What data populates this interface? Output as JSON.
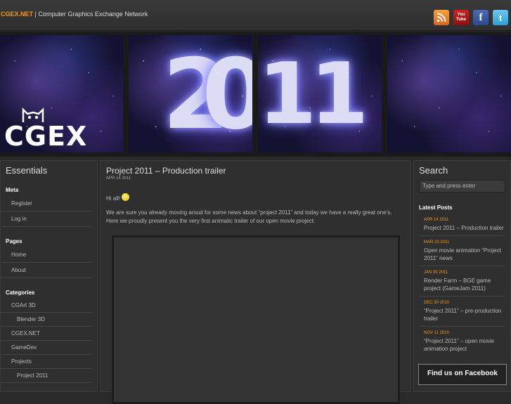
{
  "header": {
    "brand": "CGEX.NET",
    "tagline": " | Computer Graphics Exchange Network",
    "social": {
      "youtube_top": "You",
      "youtube_bottom": "Tube",
      "facebook": "f",
      "twitter": "t"
    }
  },
  "banner": {
    "digits": [
      "2",
      "0",
      "1",
      "1"
    ],
    "logo": "CGEX"
  },
  "sidebar_left": {
    "title": "Essentials",
    "meta_title": "Meta",
    "meta_items": [
      "Register",
      "Log in"
    ],
    "pages_title": "Pages",
    "pages_items": [
      "Home",
      "About"
    ],
    "categories_title": "Categories",
    "categories_items": [
      "CGArt 3D",
      "Blender 3D",
      "CGEX.NET",
      "GameDev",
      "Projects",
      "Project 2011"
    ]
  },
  "post": {
    "title": "Project 2011 – Production trailer",
    "date": "APR 14 2011",
    "greeting": "Hi all!",
    "body": "We are sure you already moving aroud for some news about “project 2011” and today we have a really great one's. Here we proudly present you the very first animatic trailer of our open movie project:"
  },
  "sidebar_right": {
    "search_title": "Search",
    "search_placeholder": "Type and press enter",
    "latest_title": "Latest Posts",
    "latest": [
      {
        "date": "APR 14 2011",
        "title": "Project 2011 – Production trailer"
      },
      {
        "date": "MAR 23 2011",
        "title": "Open movie animation “Project 2011” news"
      },
      {
        "date": "JAN 30 2011",
        "title": "Render Farm – BGE game project (GameJam 2011)"
      },
      {
        "date": "DEC 30 2010",
        "title": "“Project 2011” – pre-production trailer"
      },
      {
        "date": "NOV 11 2010",
        "title": "“Project 2011” – open movie animation project"
      }
    ],
    "facebook_box": "Find us on Facebook"
  },
  "colors": {
    "accent": "#f29a1a",
    "background": "#2a2a2a",
    "panel": "#2f2f2f"
  }
}
